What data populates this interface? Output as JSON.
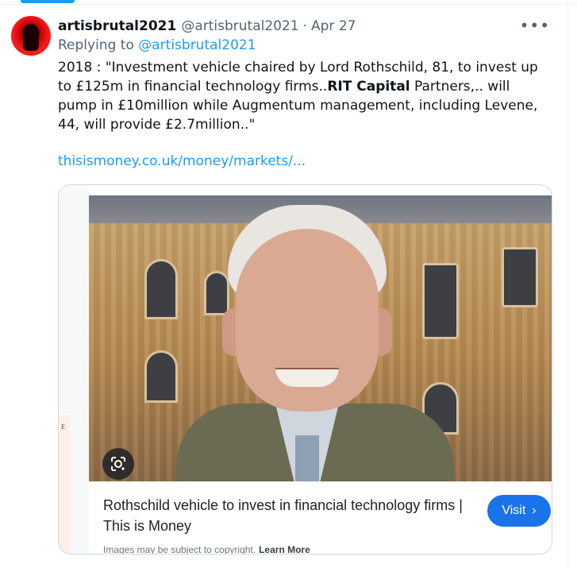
{
  "tweet": {
    "display_name": "artisbrutal2021",
    "handle": "@artisbrutal2021",
    "separator": "·",
    "date": "Apr 27",
    "more_icon": "more-horizontal-icon",
    "replying_prefix": "Replying to",
    "replying_to": "@artisbrutal2021",
    "text_part1": "2018 : \"Investment vehicle chaired by Lord Rothschild, 81, to invest up to £125m in financial technology firms..",
    "text_bold": "RIT Capital",
    "text_part2": " Partners,.. will  pump in £10million while Augmentum management, including Levene, 44,  will provide £2.7million..\"",
    "link_text": "thisismoney.co.uk/money/markets/..."
  },
  "card": {
    "left_strip_text": "E",
    "lens_icon": "google-lens-icon",
    "title": "Rothschild vehicle to invest in financial technology firms | This is Money",
    "visit_label": "Visit",
    "visit_icon": "chevron-right-icon",
    "copyright_text": "Images may be subject to copyright.",
    "learn_more": "Learn More"
  },
  "colors": {
    "accent": "#1d9bf0",
    "visit_button": "#1a73e8",
    "secondary_text": "#536471"
  }
}
